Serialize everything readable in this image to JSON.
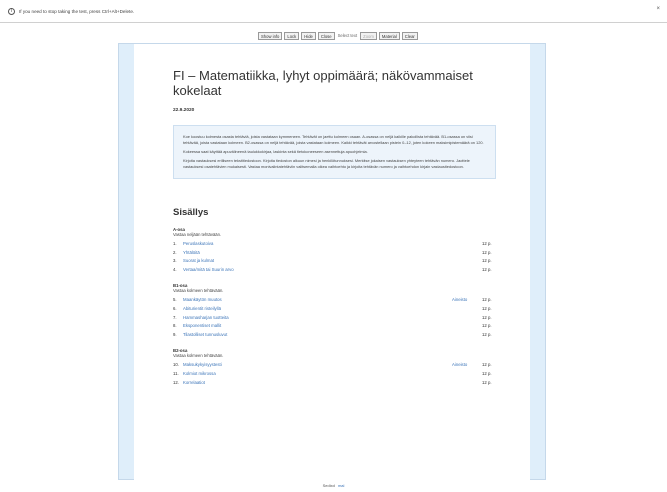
{
  "info_bar": {
    "message": "If you need to stop taking the test, press Ctrl+Alt+Delete.",
    "close_glyph": "×"
  },
  "toolbar": {
    "show_info": "Show info",
    "lock": "Lock",
    "hide": "Hide",
    "close": "Close",
    "select_text": "Select text",
    "zoom": "Zoom",
    "material": "Material",
    "clear": "Clear"
  },
  "exam": {
    "title": "FI – Matematiikka, lyhyt oppimäärä; näkövammaiset kokelaat",
    "date": "22.9.2020",
    "instructions": [
      "Koe koostuu kolmesta osasta tehtäviä, joista vastataan kymmeneen. Tehtävät on jaettu kolmeen osaan. A-osassa on neljä kaikille pakollista tehtävää. B1-osassa on viisi tehtävää, joista vastataan kolmeen. B2-osassa on neljä tehtävää, joista vastataan kolmeen. Kaikki tehtävät arvostellaan pistein 0–12, joten kokeen maksimipistemäärä on 120.",
      "Kokeessa saat käyttää apuvälineenä taulukkokirjaa, laskinta sekä tietokoneeseen asennettuja apuohjelmia.",
      "Kirjoita vastauksesi erilliseen tekstitiedostoon. Kirjoita tiedoston alkuun nimesi ja henkilötunnuksesi. Merkitse jokaisen vastauksen yhteyteen tehtävän numero. Jaottele vastauksesi osatehtävien mukaisesti. Vastaa monivalintatehtäviin valitsemalla oikea vaihtoehto ja kirjoita tehtävän numero ja vaihtoehdon kirjain vastaustiedostoon."
    ]
  },
  "toc": {
    "title": "Sisällys",
    "sections": [
      {
        "name": "A-osa",
        "instruction": "Vastaa neljään tehtävään.",
        "items": [
          {
            "num": "1.",
            "label": "Peruslaskutoiva",
            "extra": "",
            "points": "12 p."
          },
          {
            "num": "2.",
            "label": "Yhtälöitä",
            "extra": "",
            "points": "12 p."
          },
          {
            "num": "3.",
            "label": "Suorat ja kulmat",
            "extra": "",
            "points": "12 p."
          },
          {
            "num": "4.",
            "label": "Vertaa/mitä tai Suurin arvo",
            "extra": "",
            "points": "12 p."
          }
        ]
      },
      {
        "name": "B1-osa",
        "instruction": "Vastaa kolmeen tehtävään.",
        "items": [
          {
            "num": "5.",
            "label": "Maankäytön muutos",
            "extra": "Aineisto",
            "points": "12 p."
          },
          {
            "num": "6.",
            "label": "Abiturientit risteilyllä",
            "extra": "",
            "points": "12 p."
          },
          {
            "num": "7.",
            "label": "Hammasharjan tuotteita",
            "extra": "",
            "points": "12 p."
          },
          {
            "num": "8.",
            "label": "Eksponentiset mallit",
            "extra": "",
            "points": "12 p."
          },
          {
            "num": "9.",
            "label": "Tilastolliset tunnusluvut",
            "extra": "",
            "points": "12 p."
          }
        ]
      },
      {
        "name": "B2-osa",
        "instruction": "Vastaa kolmeen tehtävään.",
        "items": [
          {
            "num": "10.",
            "label": "Maksukykyisyystesti",
            "extra": "Aineisto",
            "points": "12 p."
          },
          {
            "num": "11.",
            "label": "Kolmiot mikrossa",
            "extra": "",
            "points": "12 p."
          },
          {
            "num": "12.",
            "label": "Korrelaatiot",
            "extra": "",
            "points": "12 p."
          }
        ]
      }
    ]
  },
  "footer": {
    "text": "Sedixd",
    "link": "mal"
  }
}
